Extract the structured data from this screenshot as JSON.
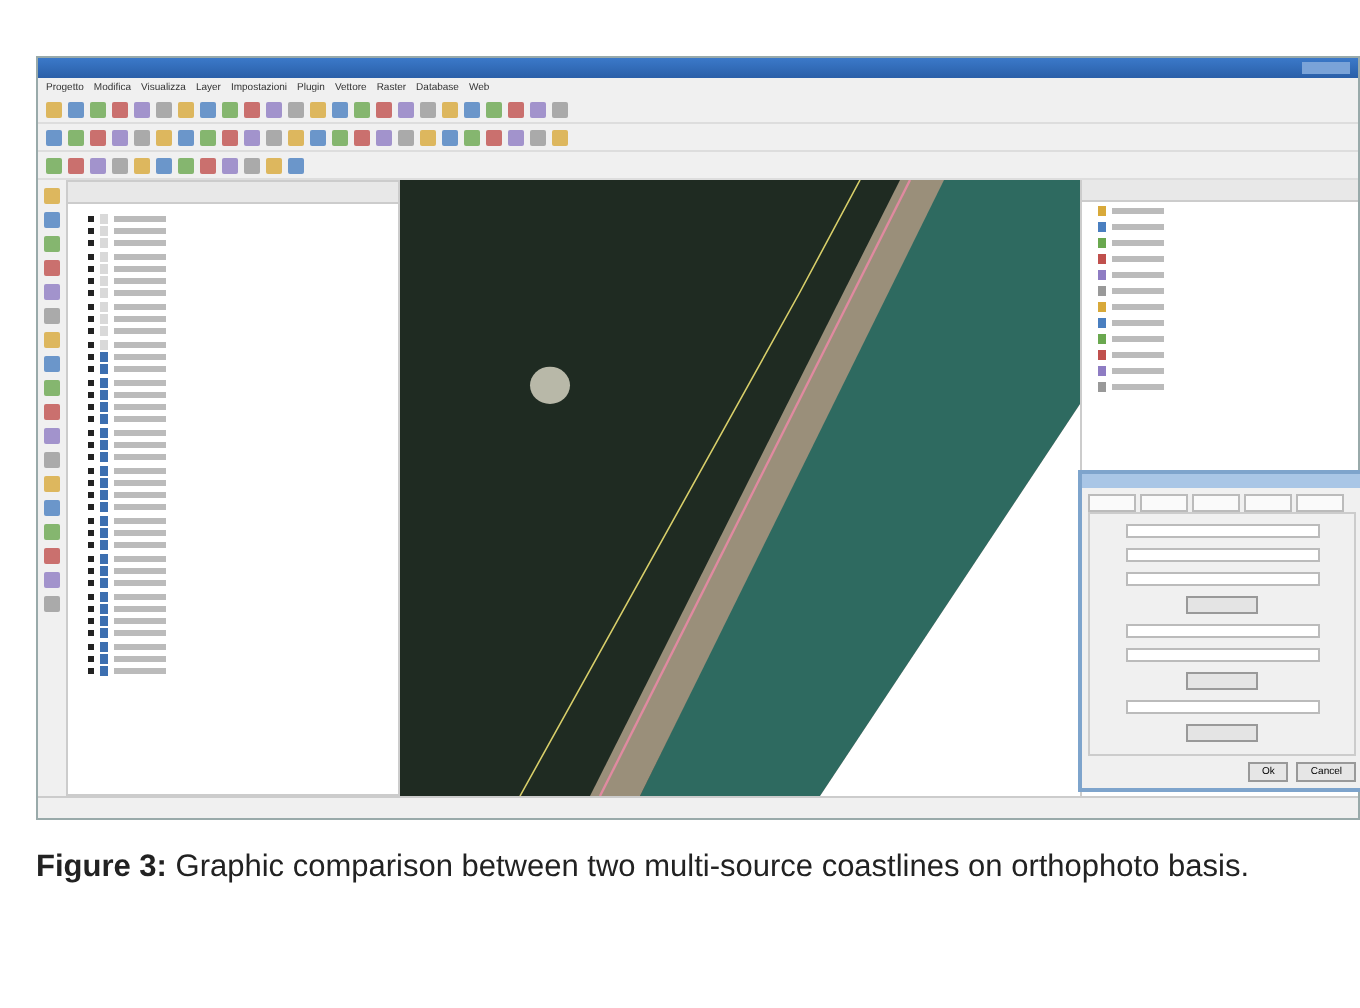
{
  "menu": [
    "Progetto",
    "Modifica",
    "Visualizza",
    "Layer",
    "Impostazioni",
    "Plugin",
    "Vettore",
    "Raster",
    "Database",
    "Web"
  ],
  "layers_panel": {
    "layers": [
      {
        "kind": "line"
      },
      {
        "kind": "line"
      },
      {
        "kind": "line"
      },
      {
        "kind": "line"
      },
      {
        "kind": "line"
      },
      {
        "kind": "line"
      },
      {
        "kind": "line"
      },
      {
        "kind": "line"
      },
      {
        "kind": "line"
      },
      {
        "kind": "line"
      },
      {
        "kind": "line"
      },
      {
        "kind": "polygon"
      },
      {
        "kind": "polygon"
      },
      {
        "kind": "polygon"
      },
      {
        "kind": "polygon"
      },
      {
        "kind": "polygon"
      },
      {
        "kind": "polygon"
      },
      {
        "kind": "polygon"
      },
      {
        "kind": "polygon"
      },
      {
        "kind": "polygon"
      },
      {
        "kind": "polygon"
      },
      {
        "kind": "polygon"
      },
      {
        "kind": "polygon"
      },
      {
        "kind": "polygon"
      },
      {
        "kind": "polygon"
      },
      {
        "kind": "polygon"
      },
      {
        "kind": "polygon"
      },
      {
        "kind": "polygon"
      },
      {
        "kind": "polygon"
      },
      {
        "kind": "polygon"
      },
      {
        "kind": "polygon"
      },
      {
        "kind": "polygon"
      },
      {
        "kind": "polygon"
      },
      {
        "kind": "polygon"
      },
      {
        "kind": "polygon"
      },
      {
        "kind": "polygon"
      },
      {
        "kind": "polygon"
      }
    ]
  },
  "dialog": {
    "buttons": [
      "Ok",
      "Cancel"
    ]
  },
  "caption": "**Figure 3:** Graphic comparison between two multi-source coastlines on orthophoto basis."
}
